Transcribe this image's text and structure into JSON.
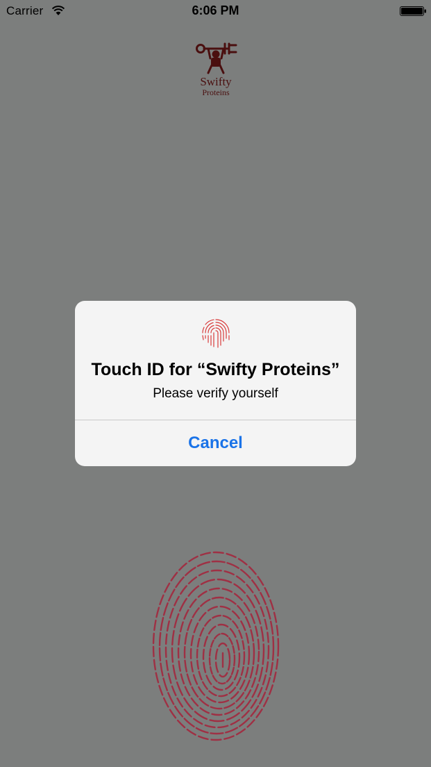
{
  "status_bar": {
    "carrier": "Carrier",
    "time": "6:06 PM",
    "wifi_icon": "wifi-icon",
    "battery_icon": "battery-icon"
  },
  "logo": {
    "line1": "Swifty",
    "line2": "Proteins",
    "color": "#4a0f0f"
  },
  "alert": {
    "icon": "fingerprint-icon",
    "title": "Touch ID for “Swifty Proteins”",
    "message": "Please verify yourself",
    "cancel_label": "Cancel",
    "cancel_color": "#1a73e8"
  },
  "background": {
    "fingerprint_icon": "fingerprint-icon",
    "fingerprint_color": "#a3283e",
    "overlay_color": "#7c7e7d"
  }
}
